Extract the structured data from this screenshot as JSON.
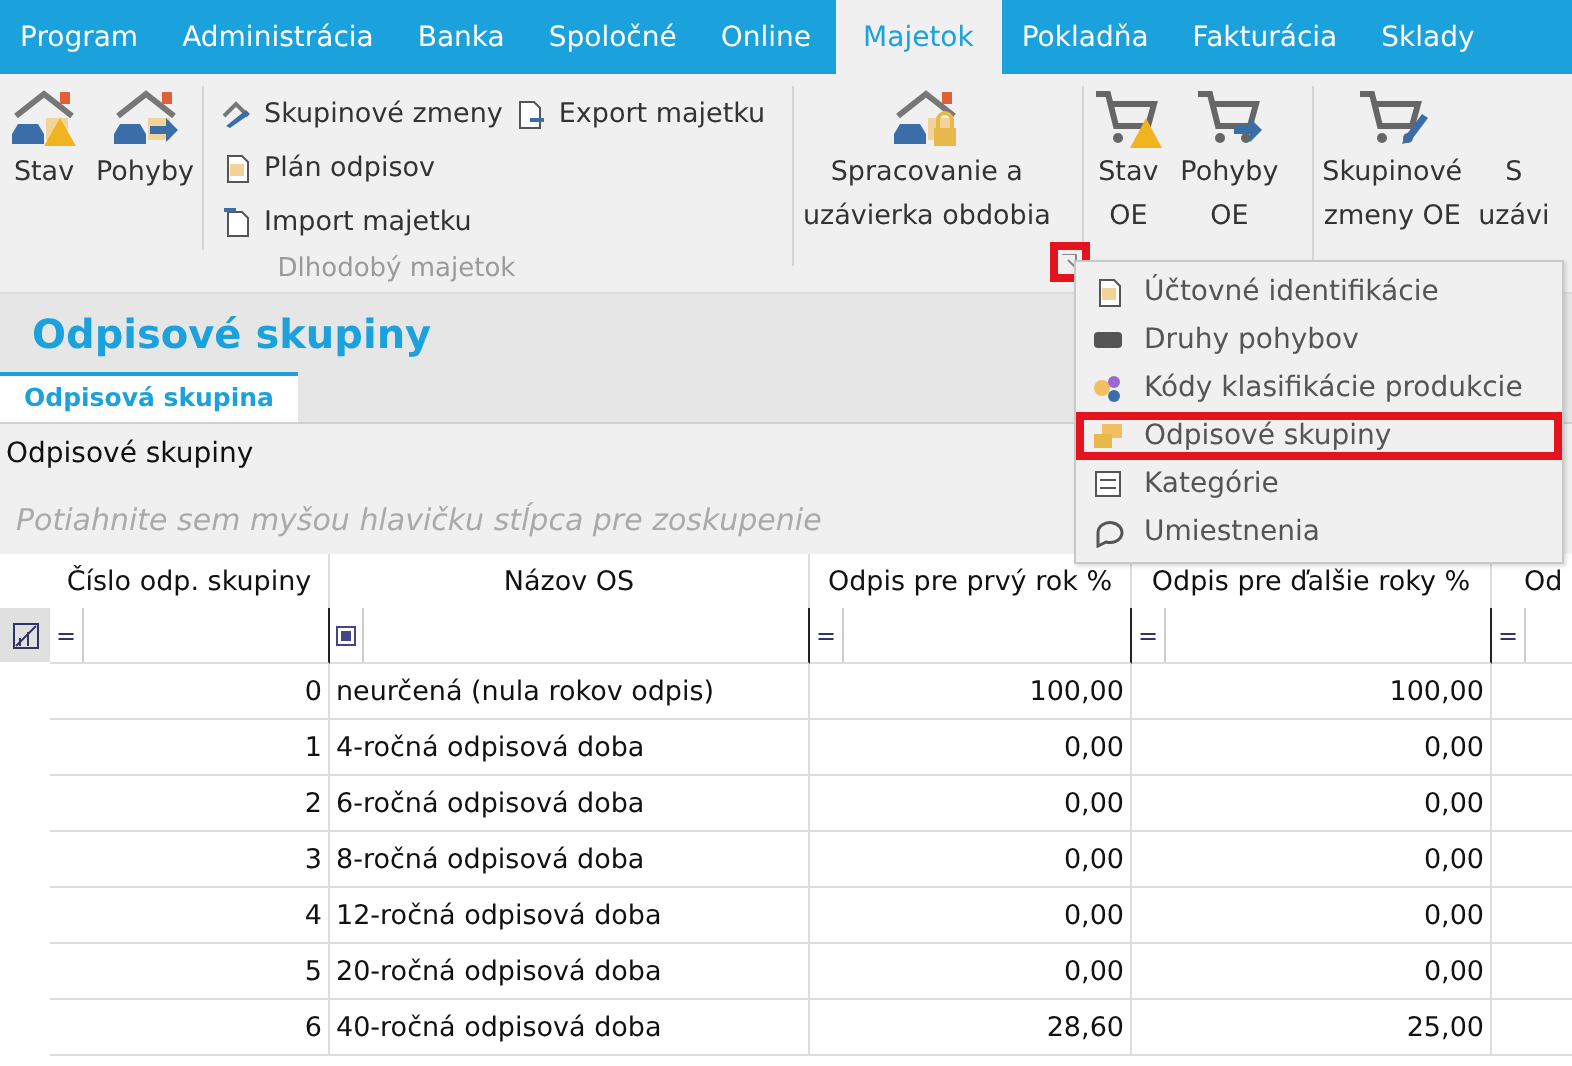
{
  "menu_tabs": [
    {
      "label": "Program",
      "selected": false
    },
    {
      "label": "Administrácia",
      "selected": false
    },
    {
      "label": "Banka",
      "selected": false
    },
    {
      "label": "Spoločné",
      "selected": false
    },
    {
      "label": "Online",
      "selected": false
    },
    {
      "label": "Majetok",
      "selected": true
    },
    {
      "label": "Pokladňa",
      "selected": false
    },
    {
      "label": "Fakturácia",
      "selected": false
    },
    {
      "label": "Sklady",
      "selected": false
    }
  ],
  "ribbon": {
    "groups": [
      {
        "label": "Dlhodobý majetok",
        "big_buttons": [
          {
            "label": [
              "Stav"
            ],
            "kind": "house-warning"
          },
          {
            "label": [
              "Pohyby"
            ],
            "kind": "house-arrow"
          }
        ],
        "small_buttons": [
          {
            "label": "Skupinové zmeny",
            "kind": "edit"
          },
          {
            "label": "Plán odpisov",
            "kind": "doc"
          },
          {
            "label": "Import majetku",
            "kind": "import"
          },
          {
            "label": "Export majetku",
            "kind": "export"
          }
        ]
      },
      {
        "big_buttons": [
          {
            "label": [
              "Spracovanie a",
              "uzávierka obdobia"
            ],
            "kind": "house-lock"
          }
        ],
        "launcher": {
          "highlighted": true
        }
      },
      {
        "big_buttons": [
          {
            "label": [
              "Stav",
              "OE"
            ],
            "kind": "cart-warning"
          },
          {
            "label": [
              "Pohyby",
              "OE"
            ],
            "kind": "cart-arrow"
          }
        ]
      },
      {
        "big_buttons": [
          {
            "label": [
              "Skupinové",
              "zmeny OE"
            ],
            "kind": "cart-edit"
          },
          {
            "label": [
              "S",
              "uzávi"
            ],
            "kind": "none"
          }
        ]
      }
    ]
  },
  "dropdown": {
    "items": [
      {
        "label": "Účtovné identifikácie",
        "kind": "doc",
        "highlighted": false
      },
      {
        "label": "Druhy pohybov",
        "kind": "bar",
        "highlighted": false
      },
      {
        "label": "Kódy klasifikácie produkcie",
        "kind": "tags",
        "highlighted": false
      },
      {
        "label": "Odpisové skupiny",
        "kind": "notes",
        "highlighted": true
      },
      {
        "label": "Kategórie",
        "kind": "list",
        "highlighted": false
      },
      {
        "label": "Umiestnenia",
        "kind": "bubble",
        "highlighted": false
      }
    ]
  },
  "page": {
    "title": "Odpisové skupiny",
    "tabs": [
      {
        "label": "Odpisová skupina",
        "selected": true
      }
    ],
    "section_label": "Odpisové skupiny",
    "group_hint": "Potiahnite sem myšou hlavičku stĺpca pre zoskupenie"
  },
  "table": {
    "columns": [
      {
        "label": "Číslo odp. skupiny",
        "filter": {
          "kind": "text",
          "symbol": "="
        }
      },
      {
        "label": "Názov OS",
        "filter": {
          "kind": "checkbox"
        }
      },
      {
        "label": "Odpis pre prvý rok %",
        "filter": {
          "kind": "text",
          "symbol": "="
        }
      },
      {
        "label": "Odpis pre ďalšie roky %",
        "filter": {
          "kind": "text",
          "symbol": "="
        }
      },
      {
        "label": "Od",
        "filter": {
          "kind": "text",
          "symbol": "="
        }
      }
    ],
    "rows": [
      [
        "0",
        "neurčená (nula rokov odpis)",
        "100,00",
        "100,00"
      ],
      [
        "1",
        "4-ročná odpisová doba",
        "0,00",
        "0,00"
      ],
      [
        "2",
        "6-ročná odpisová doba",
        "0,00",
        "0,00"
      ],
      [
        "3",
        "8-ročná odpisová doba",
        "0,00",
        "0,00"
      ],
      [
        "4",
        "12-ročná odpisová doba",
        "0,00",
        "0,00"
      ],
      [
        "5",
        "20-ročná odpisová doba",
        "0,00",
        "0,00"
      ],
      [
        "6",
        "40-ročná odpisová doba",
        "28,60",
        "25,00"
      ]
    ]
  }
}
